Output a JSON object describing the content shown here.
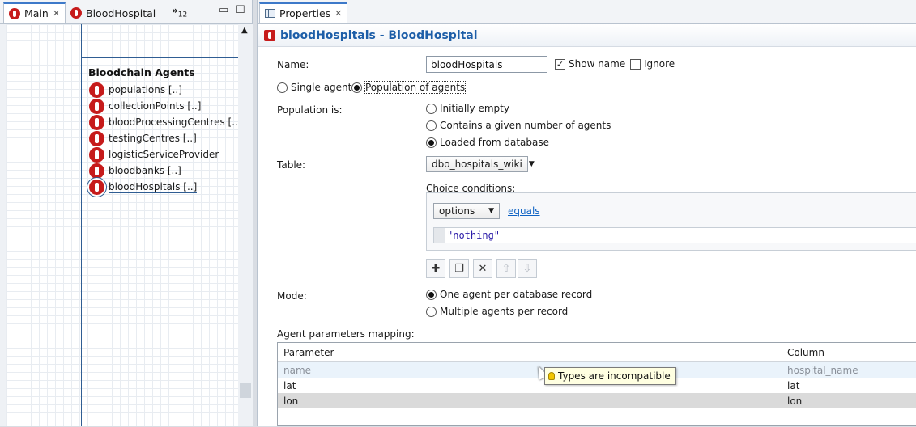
{
  "left": {
    "tabs": [
      {
        "label": "Main"
      },
      {
        "label": "BloodHospital"
      }
    ],
    "overflow_label": "»",
    "overflow_count": "12",
    "minimize_glyph": "▭",
    "maximize_glyph": "☐",
    "section_title": "Bloodchain Agents",
    "agents": [
      {
        "label": "populations [..]"
      },
      {
        "label": "collectionPoints [..]"
      },
      {
        "label": "bloodProcessingCentres [..]"
      },
      {
        "label": "testingCentres [..]"
      },
      {
        "label": "logisticServiceProvider"
      },
      {
        "label": "bloodbanks [..]"
      },
      {
        "label": "bloodHospitals [..]"
      }
    ]
  },
  "right": {
    "tab_label": "Properties",
    "header_title": "bloodHospitals - BloodHospital",
    "name_label": "Name:",
    "name_value": "bloodHospitals",
    "show_name_label": "Show name",
    "show_name_checked": true,
    "ignore_label": "Ignore",
    "ignore_checked": false,
    "agent_mode": {
      "single_label": "Single agent",
      "population_label": "Population of agents",
      "selected": "population"
    },
    "population_is_label": "Population is:",
    "population_options": [
      {
        "label": "Initially empty",
        "selected": false
      },
      {
        "label": "Contains a given number of agents",
        "selected": false
      },
      {
        "label": "Loaded from database",
        "selected": true
      }
    ],
    "table_label": "Table:",
    "table_value": "dbo_hospitals_wiki",
    "choice_conditions_label": "Choice conditions:",
    "choice_select_value": "options",
    "choice_operator_link": "equals",
    "choice_value": "\"nothing\"",
    "mode_label": "Mode:",
    "mode_options": [
      {
        "label": "One agent per database record",
        "selected": true
      },
      {
        "label": "Multiple agents per record",
        "selected": false
      }
    ],
    "mapping_label": "Agent parameters mapping:",
    "mapping_columns": {
      "parameter": "Parameter",
      "column": "Column"
    },
    "mapping_rows": [
      {
        "parameter": "name",
        "column": "hospital_name"
      },
      {
        "parameter": "lat",
        "column": "lat"
      },
      {
        "parameter": "lon",
        "column": "lon"
      }
    ],
    "tooltip_text": "Types are incompatible"
  },
  "colors": {
    "accent": "#1d5ea8",
    "agent_red": "#c61b1b",
    "link": "#0f63c4"
  }
}
